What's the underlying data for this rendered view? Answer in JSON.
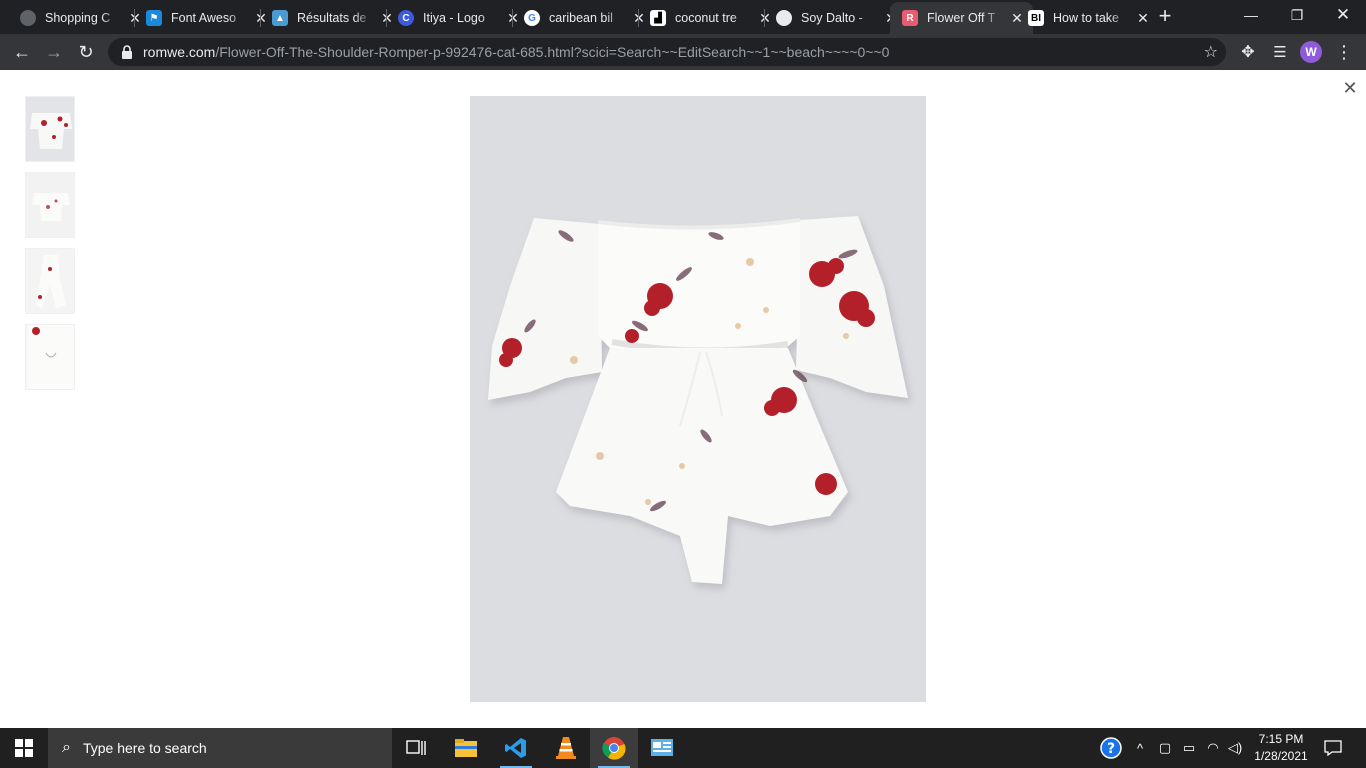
{
  "browser": {
    "tabs": [
      {
        "title": "Shopping C",
        "favicon": "globe-icon"
      },
      {
        "title": "Font Aweso",
        "favicon": "flag-icon"
      },
      {
        "title": "Résultats de",
        "favicon": "image-icon"
      },
      {
        "title": "Itiya - Logo",
        "favicon": "canva-icon"
      },
      {
        "title": "caribean bil",
        "favicon": "google-icon"
      },
      {
        "title": "coconut tre",
        "favicon": "unsplash-icon"
      },
      {
        "title": "Soy Dalto -",
        "favicon": "globe-icon"
      },
      {
        "title": "Flower Off T",
        "favicon": "romwe-icon",
        "active": true
      },
      {
        "title": "How to take",
        "favicon": "bi-icon"
      }
    ],
    "address": {
      "domain": "romwe.com",
      "path": "/Flower-Off-The-Shoulder-Romper-p-992476-cat-685.html?scici=Search~~EditSearch~~1~~beach~~~~0~~0"
    },
    "profile_initial": "W"
  },
  "gallery": {
    "thumbnails": [
      "front-view",
      "back-view",
      "side-view",
      "detail-view"
    ],
    "colors": {
      "background": "#dcdde1",
      "fabric": "#f7f7f5",
      "flower": "#b3202a",
      "leaf": "#6b4a5a"
    }
  },
  "taskbar": {
    "search_placeholder": "Type here to search",
    "time": "7:15 PM",
    "date": "1/28/2021"
  }
}
